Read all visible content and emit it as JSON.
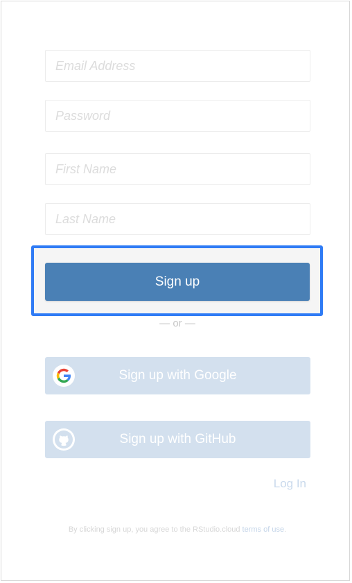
{
  "form": {
    "email": {
      "placeholder": "Email Address",
      "value": ""
    },
    "password": {
      "placeholder": "Password",
      "value": ""
    },
    "first_name": {
      "placeholder": "First Name",
      "value": ""
    },
    "last_name": {
      "placeholder": "Last Name",
      "value": ""
    },
    "signup_label": "Sign up",
    "or_text": "— or —"
  },
  "oauth": {
    "google_label": "Sign up with Google",
    "github_label": "Sign up with GitHub",
    "google_icon": "google-icon",
    "github_icon": "github-icon"
  },
  "footer": {
    "login_label": "Log In",
    "terms_prefix": "By clicking sign up, you agree to the RStudio.cloud ",
    "terms_link": "terms of use",
    "terms_suffix": "."
  },
  "colors": {
    "primary": "#4a80b5",
    "highlight_border": "#2f7bf5",
    "oauth_background": "#d3e0ee"
  }
}
